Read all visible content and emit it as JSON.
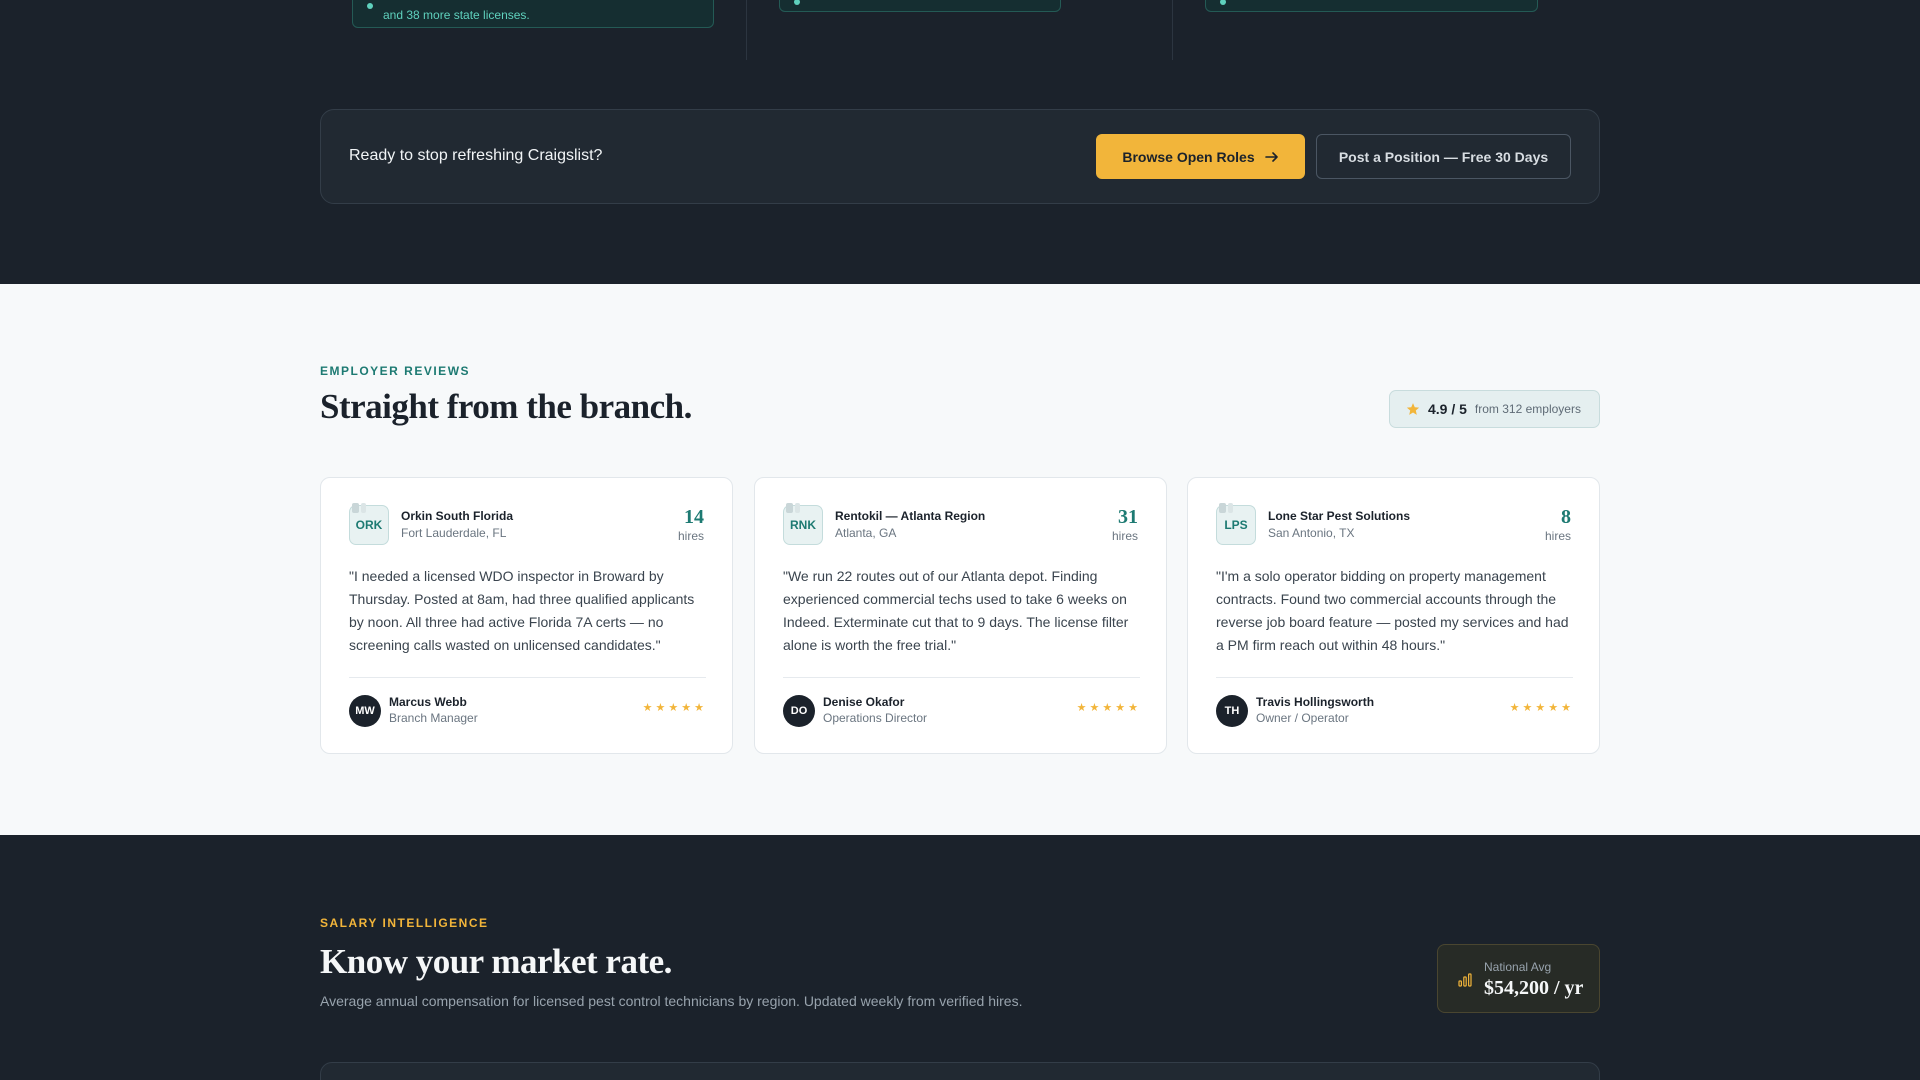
{
  "top_notes": [
    {
      "text": "and 38 more state licenses."
    },
    {
      "text": ""
    },
    {
      "text": ""
    }
  ],
  "cta": {
    "text": "Ready to stop refreshing Craigslist?",
    "primary_label": "Browse Open Roles",
    "secondary_label": "Post a Position — Free 30 Days"
  },
  "reviews": {
    "eyebrow": "EMPLOYER REVIEWS",
    "title": "Straight from the branch.",
    "rating": {
      "score": "4.9 / 5",
      "from": "from 312 employers"
    },
    "cards": [
      {
        "logo": "ORK",
        "company": "Orkin South Florida",
        "location": "Fort Lauderdale, FL",
        "hires": "14",
        "hires_label": "hires",
        "quote": "\"I needed a licensed WDO inspector in Broward by Thursday. Posted at 8am, had three qualified applicants by noon. All three had active Florida 7A certs — no screening calls wasted on unlicensed candidates.\"",
        "initials": "MW",
        "person": "Marcus Webb",
        "role": "Branch Manager",
        "stars": 5
      },
      {
        "logo": "RNK",
        "company": "Rentokil — Atlanta Region",
        "location": "Atlanta, GA",
        "hires": "31",
        "hires_label": "hires",
        "quote": "\"We run 22 routes out of our Atlanta depot. Finding experienced commercial techs used to take 6 weeks on Indeed. Exterminate cut that to 9 days. The license filter alone is worth the free trial.\"",
        "initials": "DO",
        "person": "Denise Okafor",
        "role": "Operations Director",
        "stars": 5
      },
      {
        "logo": "LPS",
        "company": "Lone Star Pest Solutions",
        "location": "San Antonio, TX",
        "hires": "8",
        "hires_label": "hires",
        "quote": "\"I'm a solo operator bidding on property management contracts. Found two commercial accounts through the reverse job board feature — posted my services and had a PM firm reach out within 48 hours.\"",
        "initials": "TH",
        "person": "Travis Hollingsworth",
        "role": "Owner / Operator",
        "stars": 5
      }
    ]
  },
  "salary": {
    "eyebrow": "SALARY INTELLIGENCE",
    "title": "Know your market rate.",
    "subtitle": "Average annual compensation for licensed pest control technicians by region. Updated weekly from verified hires.",
    "national_avg_label": "National Avg",
    "national_avg_value": "$54,200 / yr"
  },
  "colors": {
    "accent_teal": "#1d7a72",
    "accent_gold": "#f2b53a",
    "dark_bg": "#1b222b"
  },
  "icons": {
    "arrow": "arrow-right-icon",
    "rating": "star-icon",
    "salary": "bar-chart-icon"
  }
}
